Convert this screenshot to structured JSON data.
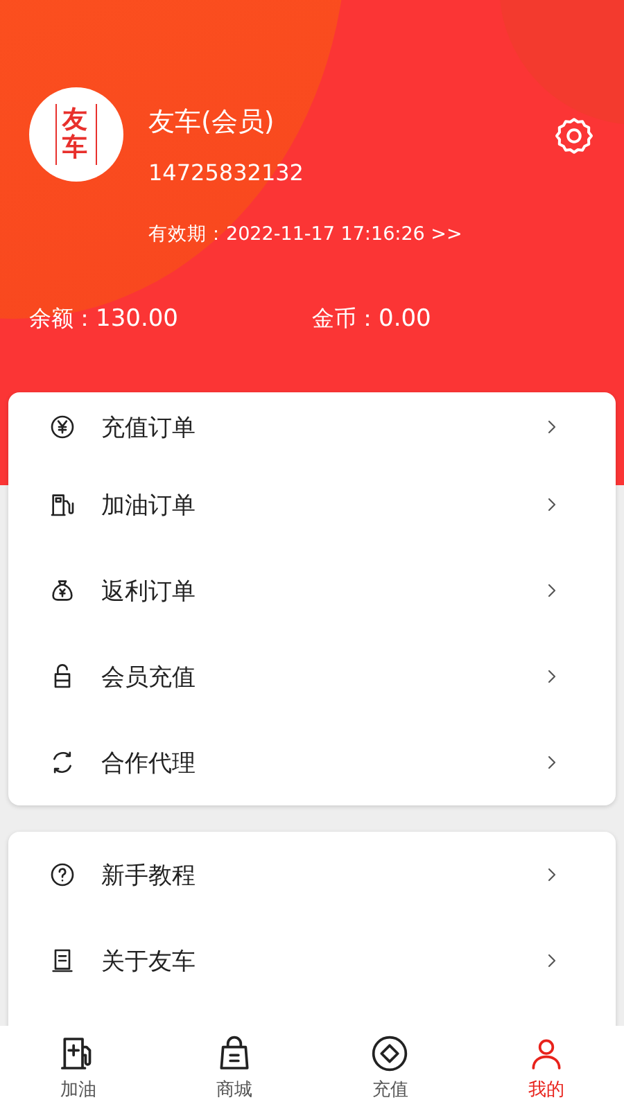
{
  "profile": {
    "logo_text": "友车",
    "name": "友车(会员)",
    "phone": "14725832132",
    "validity": "有效期：2022-11-17 17:16:26 >>"
  },
  "balances": [
    {
      "label": "余额：",
      "value": "130.00"
    },
    {
      "label": "金币：",
      "value": "0.00"
    }
  ],
  "menu_groups": [
    {
      "items": [
        {
          "label": "充值订单"
        },
        {
          "label": "加油订单"
        },
        {
          "label": "返利订单"
        },
        {
          "label": "会员充值"
        },
        {
          "label": "合作代理"
        }
      ]
    },
    {
      "items": [
        {
          "label": "新手教程"
        },
        {
          "label": "关于友车"
        }
      ]
    }
  ],
  "tab_bar": [
    {
      "label": "加油",
      "selected": false
    },
    {
      "label": "商城",
      "selected": false
    },
    {
      "label": "充值",
      "selected": false
    },
    {
      "label": "我的",
      "selected": true
    }
  ]
}
